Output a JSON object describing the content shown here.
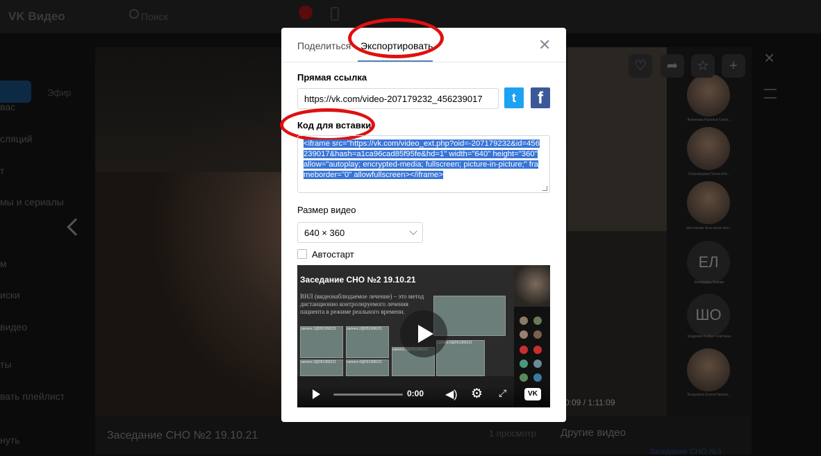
{
  "app": {
    "brand": "VK Видео",
    "search_placeholder": "Поиск"
  },
  "sidebar": {
    "chip": "Эфир",
    "items": [
      "вас",
      "сляций",
      "т",
      "мы и сериалы",
      "м",
      "иски",
      "видео",
      "ты",
      "вать плейлист",
      "нуть"
    ]
  },
  "player": {
    "timecode": "0:09 / 1:11:09",
    "participants": [
      {
        "type": "photo",
        "name": "Жиенкова Наталья Серге..."
      },
      {
        "type": "photo",
        "name": "Скоромудова Ганна Але..."
      },
      {
        "type": "photo",
        "name": "Шестакова Анастасия Але..."
      },
      {
        "type": "initials",
        "initials": "ЕЛ",
        "name": "Екатерина Львова"
      },
      {
        "type": "initials",
        "initials": "ШО",
        "name": "Шадрина Софья Олеговна"
      },
      {
        "type": "photo",
        "name": "Бездняков Елена Никола..."
      }
    ]
  },
  "below": {
    "title": "Заседание СНО №2 19.10.21",
    "views": "1 просмотр",
    "other_videos": "Другие видео",
    "other_item": "Заседание СНО №3"
  },
  "modal": {
    "tabs": [
      {
        "label": "Поделиться",
        "active": false
      },
      {
        "label": "Экспортировать",
        "active": true
      }
    ],
    "direct_link_label": "Прямая ссылка",
    "direct_link_value": "https://vk.com/video-207179232_456239017",
    "embed_label": "Код для вставки",
    "embed_code": "<iframe src=\"https://vk.com/video_ext.php?oid=-207179232&id=456239017&hash=a1ca96cad85f95fe&hd=1\" width=\"640\" height=\"360\" allow=\"autoplay; encrypted-media; fullscreen; picture-in-picture;\" frameborder=\"0\" allowfullscreen></iframe>",
    "size_label": "Размер видео",
    "size_value": "640 × 360",
    "autostart_label": "Автостарт",
    "autostart_checked": false
  },
  "preview": {
    "title": "Заседание СНО №2 19.10.21",
    "slide_text": "ВНЛ (видеонаблюдаемое лечение) – это метод дистанционно контролируемого лечения пациента в режиме реального времени.",
    "cameras": [
      "camera 1@051368121",
      "camera 2@051368121",
      "camera 3@051368121",
      "camera 4@051368121",
      "camera 5@051368121",
      "camera 6@051368121"
    ],
    "time": "0:00"
  },
  "colors": {
    "accent": "#5181b8",
    "annotation": "#e01010",
    "twitter": "#1da1f2",
    "facebook": "#3b5998",
    "selection": "#3875d7"
  },
  "icons": [
    "search-icon",
    "close-icon",
    "twitter-icon",
    "facebook-icon",
    "chevron-down-icon",
    "play-icon",
    "volume-icon",
    "gear-icon",
    "fullscreen-icon",
    "vk-logo-icon",
    "heart-icon",
    "share-icon",
    "star-icon",
    "plus-icon",
    "list-icon",
    "chevron-left-icon"
  ]
}
